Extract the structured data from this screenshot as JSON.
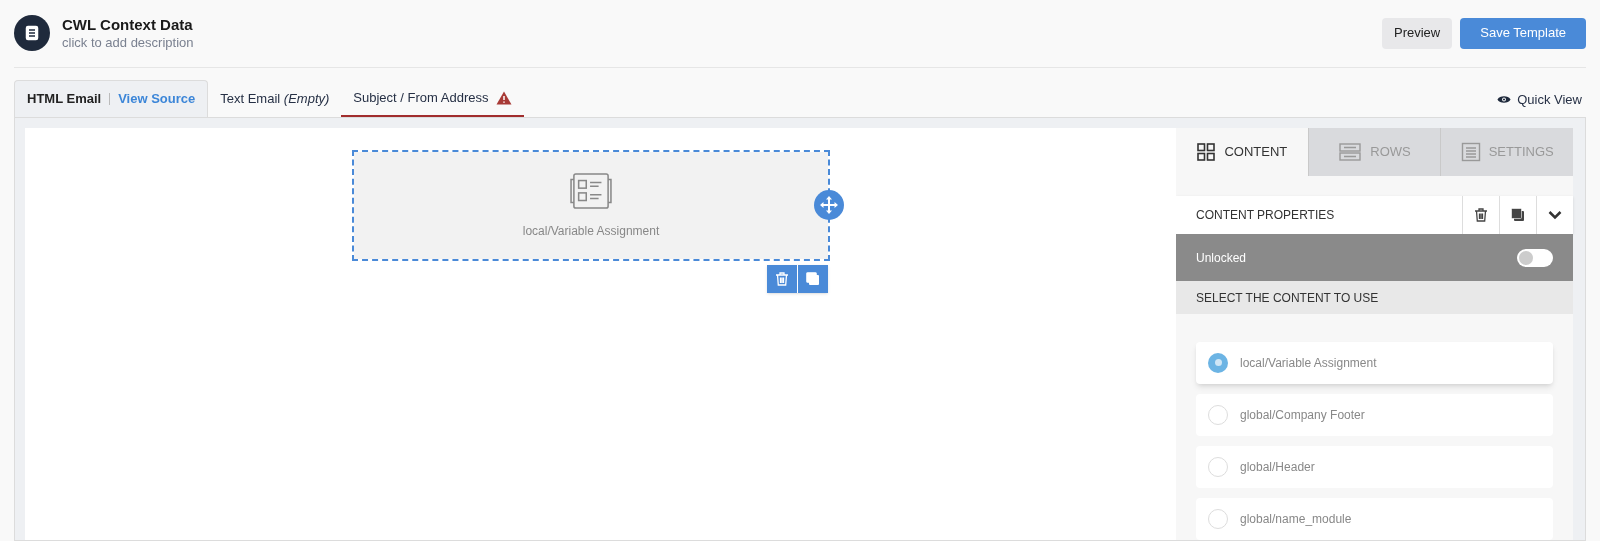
{
  "header": {
    "title": "CWL Context Data",
    "description": "click to add description",
    "buttons": [
      {
        "label": "Preview",
        "kind": "secondary"
      },
      {
        "label": "Save Template",
        "kind": "primary"
      }
    ]
  },
  "tabs": [
    {
      "label": "HTML Email",
      "link": "View Source",
      "selected": true,
      "warning": false
    },
    {
      "label": "Text Email *(Empty)*",
      "selected": false,
      "warning": false
    },
    {
      "label": "Subject / From Address",
      "selected": false,
      "warning": true
    }
  ],
  "quick_view": "Quick View",
  "canvas": {
    "block": {
      "label": "local/Variable Assignment",
      "selected": true
    }
  },
  "panel": {
    "tabs": [
      {
        "label": "CONTENT",
        "kind": "grid",
        "selected": true
      },
      {
        "label": "ROWS",
        "kind": "rows",
        "selected": false
      },
      {
        "label": "SETTINGS",
        "kind": "settings",
        "selected": false
      }
    ],
    "properties_title": "CONTENT PROPERTIES",
    "lock": {
      "label": "Unlocked",
      "on": false
    },
    "select_title": "SELECT THE CONTENT TO USE",
    "options": [
      {
        "label": "local/Variable Assignment",
        "selected": true
      },
      {
        "label": "global/Company Footer",
        "selected": false
      },
      {
        "label": "global/Header",
        "selected": false
      },
      {
        "label": "global/name_module",
        "selected": false
      }
    ]
  }
}
